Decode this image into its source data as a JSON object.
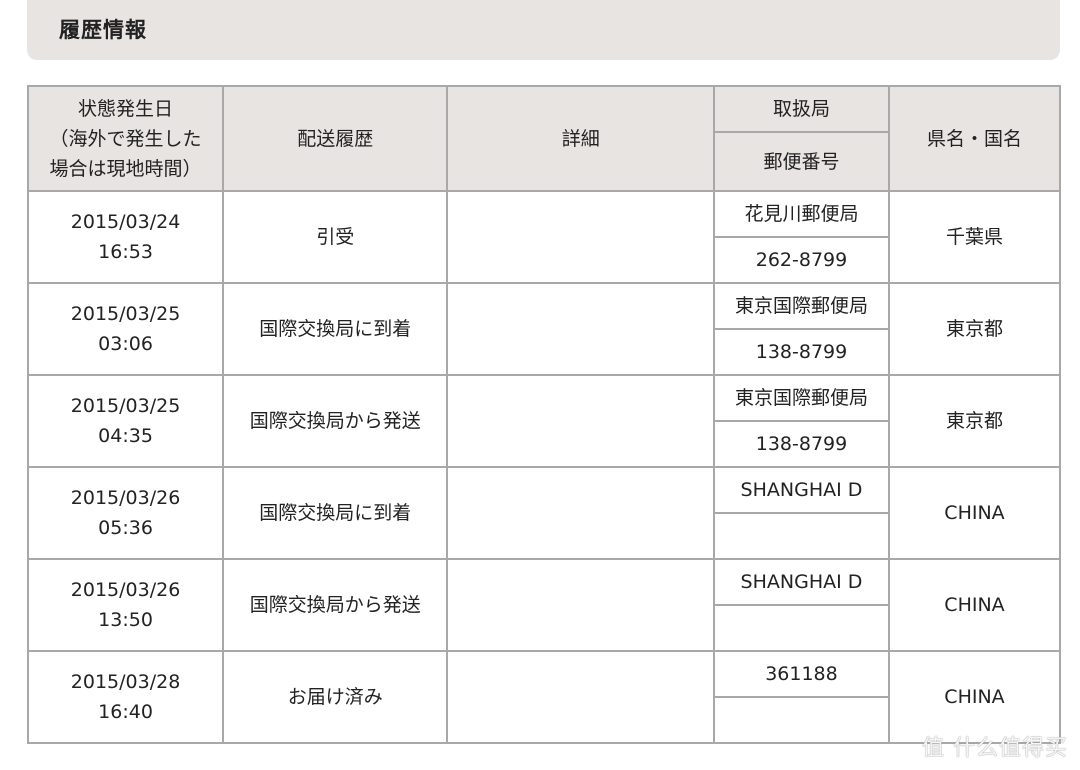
{
  "section": {
    "title": "履歴情報"
  },
  "table": {
    "headers": {
      "date": "状態発生日\n（海外で発生した\n場合は現地時間）",
      "date_line1": "状態発生日",
      "date_line2": "（海外で発生した",
      "date_line3": "場合は現地時間）",
      "event": "配送履歴",
      "detail": "詳細",
      "office": "取扱局",
      "postal": "郵便番号",
      "prefecture": "県名・国名"
    },
    "rows": [
      {
        "date": "2015/03/24",
        "time": "16:53",
        "event": "引受",
        "detail": "",
        "office": "花見川郵便局",
        "postal": "262-8799",
        "prefecture": "千葉県"
      },
      {
        "date": "2015/03/25",
        "time": "03:06",
        "event": "国際交換局に到着",
        "detail": "",
        "office": "東京国際郵便局",
        "postal": "138-8799",
        "prefecture": "東京都"
      },
      {
        "date": "2015/03/25",
        "time": "04:35",
        "event": "国際交換局から発送",
        "detail": "",
        "office": "東京国際郵便局",
        "postal": "138-8799",
        "prefecture": "東京都"
      },
      {
        "date": "2015/03/26",
        "time": "05:36",
        "event": "国際交換局に到着",
        "detail": "",
        "office": "SHANGHAI D",
        "postal": "",
        "prefecture": "CHINA"
      },
      {
        "date": "2015/03/26",
        "time": "13:50",
        "event": "国際交換局から発送",
        "detail": "",
        "office": "SHANGHAI D",
        "postal": "",
        "prefecture": "CHINA"
      },
      {
        "date": "2015/03/28",
        "time": "16:40",
        "event": "お届け済み",
        "detail": "",
        "office": "361188",
        "postal": "",
        "prefecture": "CHINA"
      }
    ]
  },
  "watermark": {
    "text": "值 什么值得买"
  }
}
